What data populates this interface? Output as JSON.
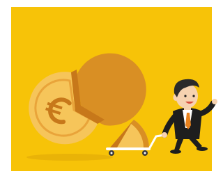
{
  "scene": {
    "icon": "euro-sign",
    "colors": {
      "background": "#f7c308",
      "coin_light": "#f6c55a",
      "coin_mid": "#eeb046",
      "coin_dark": "#d98f24",
      "coin_edge": "#c7781a",
      "suit": "#1e1e1e",
      "tie": "#e8821e",
      "skin": "#f6d2b0",
      "hair": "#2a2a2a",
      "cart": "#ffffff",
      "wheel": "#3a3a3a"
    }
  }
}
